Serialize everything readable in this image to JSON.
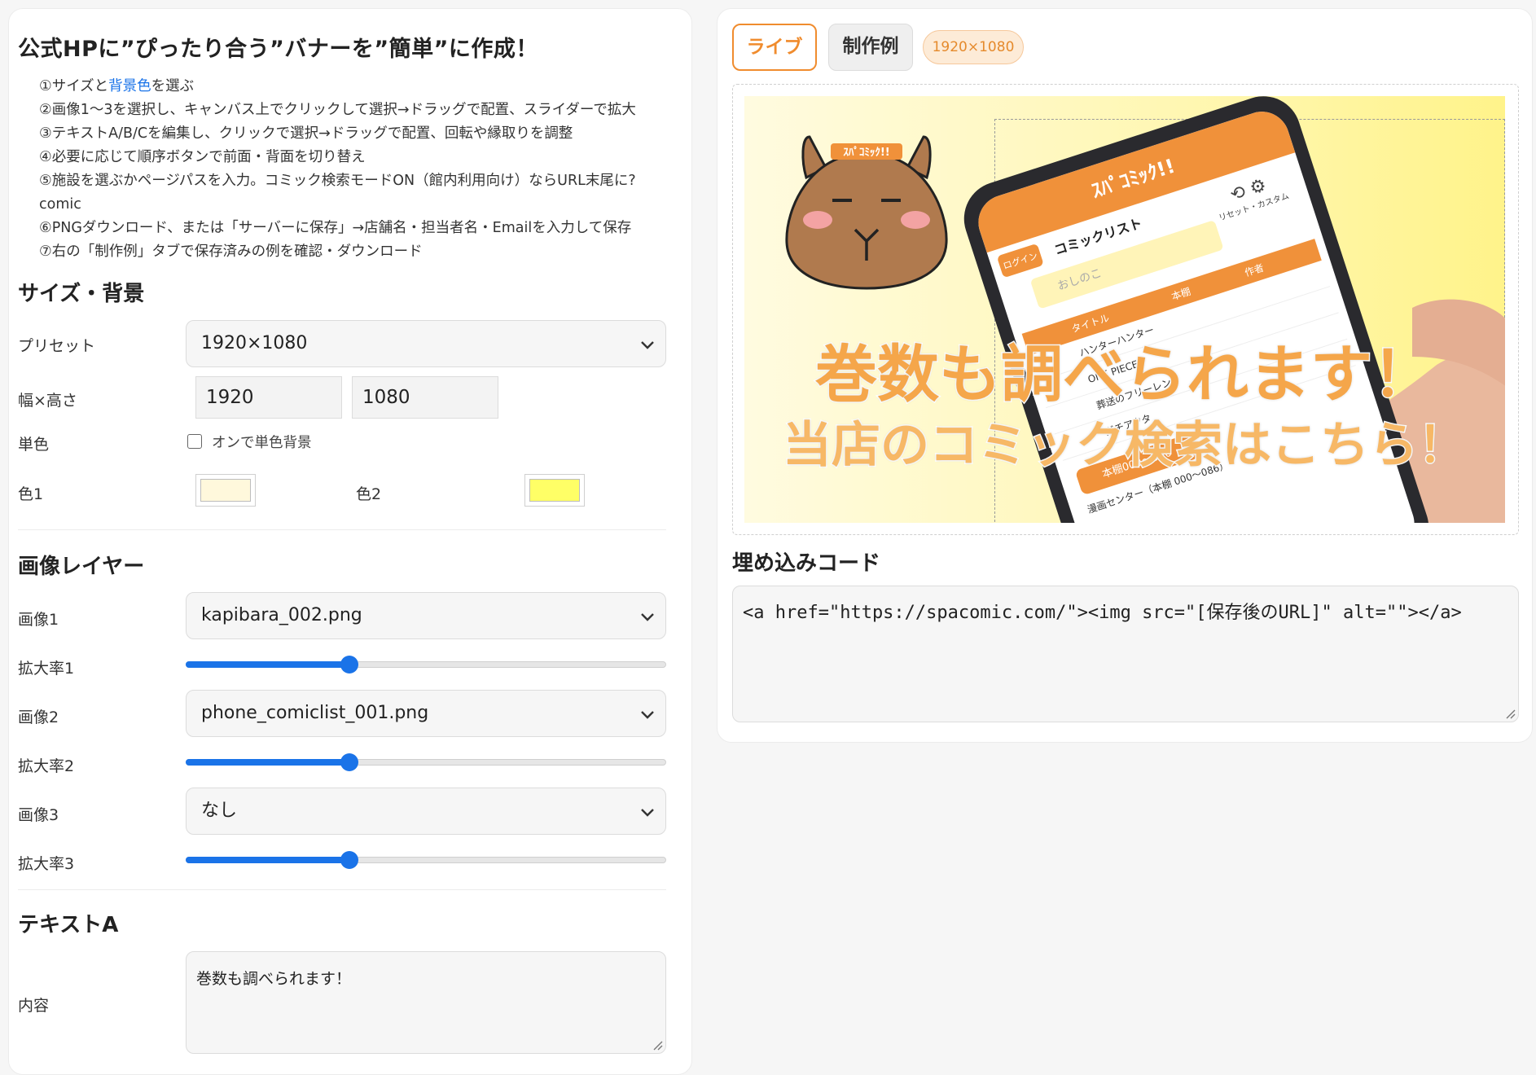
{
  "left": {
    "title": "公式HPに”ぴったり合う”バナーを”簡単”に作成！",
    "steps": [
      {
        "pre": "①サイズと",
        "hl": "背景色",
        "post": "を選ぶ"
      },
      {
        "pre": "②画像1〜3を選択し、キャンバス上でクリックして選択→ドラッグで配置、スライダーで拡大",
        "hl": "",
        "post": ""
      },
      {
        "pre": "③テキストA/B/Cを編集し、クリックで選択→ドラッグで配置、回転や縁取りを調整",
        "hl": "",
        "post": ""
      },
      {
        "pre": "④必要に応じて順序ボタンで前面・背面を切り替え",
        "hl": "",
        "post": ""
      },
      {
        "pre": "⑤施設を選ぶかページパスを入力。コミック検索モードON（館内利用向け）ならURL末尾に?comic",
        "hl": "",
        "post": ""
      },
      {
        "pre": "⑥PNGダウンロード、または「サーバーに保存」→店舗名・担当者名・Emailを入力して保存",
        "hl": "",
        "post": ""
      },
      {
        "pre": "⑦右の「制作例」タブで保存済みの例を確認・ダウンロード",
        "hl": "",
        "post": ""
      }
    ],
    "size_section": {
      "title": "サイズ・背景",
      "preset_label": "プリセット",
      "preset_value": "1920×1080",
      "wh_label": "幅×高さ",
      "width": "1920",
      "height": "1080",
      "solid_label": "単色",
      "solid_checkbox_label": "オンで単色背景",
      "solid_checked": false,
      "color1_label": "色1",
      "color1": "#fff8dc",
      "color2_label": "色2",
      "color2": "#ffff66"
    },
    "image_section": {
      "title": "画像レイヤー",
      "layers": [
        {
          "label": "画像1",
          "value": "kapibara_002.png",
          "scale_label": "拡大率1",
          "scale": 0.34
        },
        {
          "label": "画像2",
          "value": "phone_comiclist_001.png",
          "scale_label": "拡大率2",
          "scale": 0.34
        },
        {
          "label": "画像3",
          "value": "なし",
          "scale_label": "拡大率3",
          "scale": 0.34
        }
      ]
    },
    "text_section": {
      "title": "テキストA",
      "content_label": "内容",
      "content": "巻数も調べられます！"
    }
  },
  "right": {
    "tab_live": "ライブ",
    "tab_works": "制作例",
    "size_badge": "1920×1080",
    "banner": {
      "line1": "巻数も調べられます！",
      "line2": "当店のコミック検索はこちら！",
      "capy_badge": "ｽﾊﾟｺﾐｯｸ!!",
      "phone_header": "ｽﾊﾟｺﾐｯｸ!!",
      "phone_list_title": "コミックリスト",
      "phone_search_placeholder": "おしのこ",
      "phone_login": "ログイン",
      "phone_reset": "リセット",
      "phone_custom": "カスタム",
      "phone_col1": "タイトル",
      "phone_col2": "本棚",
      "phone_col3": "作者",
      "phone_rows": [
        "ハンターハンター",
        "ONE PIECE",
        "葬送のフリーレン",
        "ガチアクタ"
      ],
      "phone_btn": "本棚000〜086",
      "phone_footer": "漫画センター（本棚 000〜086）"
    },
    "embed_title": "埋め込みコード",
    "embed_code": "<a href=\"https://spacomic.com/\"><img src=\"[保存後のURL]\" alt=\"\"></a>"
  },
  "colors": {
    "accent": "#f08c2e",
    "slider": "#1a73e8",
    "link": "#1a73e8"
  },
  "icons": {
    "chevron": "chevron-down-icon",
    "resize": "resize-grip-icon"
  }
}
